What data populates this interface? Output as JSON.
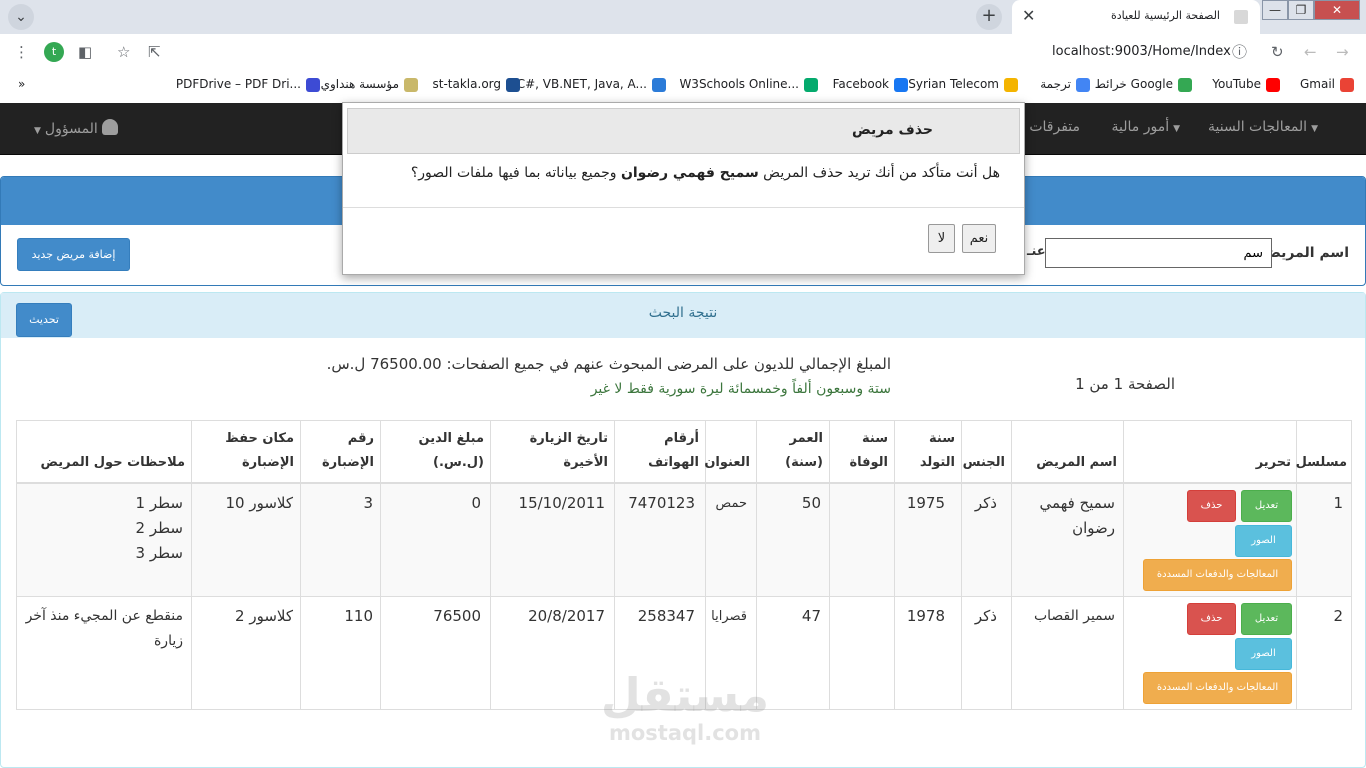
{
  "browser": {
    "tab_title": "الصفحة الرئيسية للعيادة",
    "tab_close": "✕",
    "new_tab": "+",
    "tab_menu": "⌄",
    "window_min": "—",
    "window_max": "❐",
    "window_close": "✕",
    "url": "localhost:9003/Home/Index",
    "profile_initial": "t",
    "bookmarks_more": "»",
    "bookmarks": [
      {
        "label": "Gmail",
        "color": "#ea4335"
      },
      {
        "label": "YouTube",
        "color": "#ff0000"
      },
      {
        "label": "خرائط Google",
        "color": "#34a853"
      },
      {
        "label": "ترجمة",
        "color": "#4285f4"
      },
      {
        "label": "Syrian Telecom",
        "color": "#f4b400"
      },
      {
        "label": "Facebook",
        "color": "#1877f2"
      },
      {
        "label": "W3Schools Online...",
        "color": "#04aa6d"
      },
      {
        "label": "C#, VB.NET, Java, A...",
        "color": "#2b7bd8"
      },
      {
        "label": "st-takla.org",
        "color": "#1d4f91"
      },
      {
        "label": "مؤسسة هنداوي",
        "color": "#c9b86a"
      },
      {
        "label": "PDFDrive – PDF Dri...",
        "color": "#3d4bd4"
      }
    ]
  },
  "navbar": {
    "dental": "المعالجات السنية",
    "finance": "أمور مالية",
    "misc": "متفرقات",
    "admin": "المسؤول",
    "caret": "▼"
  },
  "search": {
    "label": "اسم المريض",
    "value": "سم",
    "partial_label": "عنـ",
    "add_button": "إضافة مريض جديد"
  },
  "results": {
    "title": "نتيجة البحث",
    "refresh": "تحديث",
    "page_info": "الصفحة 1 من 1",
    "total_line": "المبلغ الإجمالي للديون على المرضى المبحوث عنهم في جميع الصفحات: 76500.00 ل.س.",
    "total_words": "ستة وسبعون ألفاً وخمسمائة ليرة سورية فقط لا غير"
  },
  "table": {
    "headers": {
      "serial": "مسلسل",
      "edit": "تحرير",
      "name": "اسم المريض",
      "gender": "الجنس",
      "birth": "سنة التولد",
      "death": "سنة الوفاة",
      "age": "العمر (سنة)",
      "address": "العنوان",
      "phones": "أرقام الهواتف",
      "last_visit": "تاريخ الزيارة الأخيرة",
      "debt": "مبلغ الدين (ل.س.)",
      "folder_no": "رقم الإضبارة",
      "folder_place": "مكان حفظ الإضبارة",
      "notes": "ملاحظات حول المريض"
    },
    "buttons": {
      "delete": "حذف",
      "edit": "تعديل",
      "images": "الصور",
      "treatments": "المعالجات والدفعات المسددة"
    },
    "rows": [
      {
        "serial": "1",
        "name": "سميح فهمي رضوان",
        "gender": "ذكر",
        "birth": "1975",
        "death": "",
        "age": "50",
        "address": "حمص",
        "phones": "7470123",
        "last_visit": "15/10/2011",
        "debt": "0",
        "folder_no": "3",
        "folder_place": "كلاسور 10",
        "notes": [
          "سطر 1",
          "سطر 2",
          "سطر 3"
        ]
      },
      {
        "serial": "2",
        "name": "سمير القصاب",
        "gender": "ذكر",
        "birth": "1978",
        "death": "",
        "age": "47",
        "address": "قصرايا",
        "phones": "258347",
        "last_visit": "20/8/2017",
        "debt": "76500",
        "folder_no": "110",
        "folder_place": "كلاسور 2",
        "notes": [
          "منقطع عن المجيء منذ آخر",
          "زيارة"
        ]
      }
    ]
  },
  "modal": {
    "title": "حذف مريض",
    "body_before": "هل أنت متأكد من أنك تريد حذف المريض ",
    "patient": "سميح فهمي رضوان",
    "body_after": " وجميع بياناته بما فيها ملفات الصور؟",
    "yes": "نعم",
    "no": "لا"
  },
  "watermark": {
    "arabic": "مستقل",
    "latin": "mostaql.com"
  }
}
